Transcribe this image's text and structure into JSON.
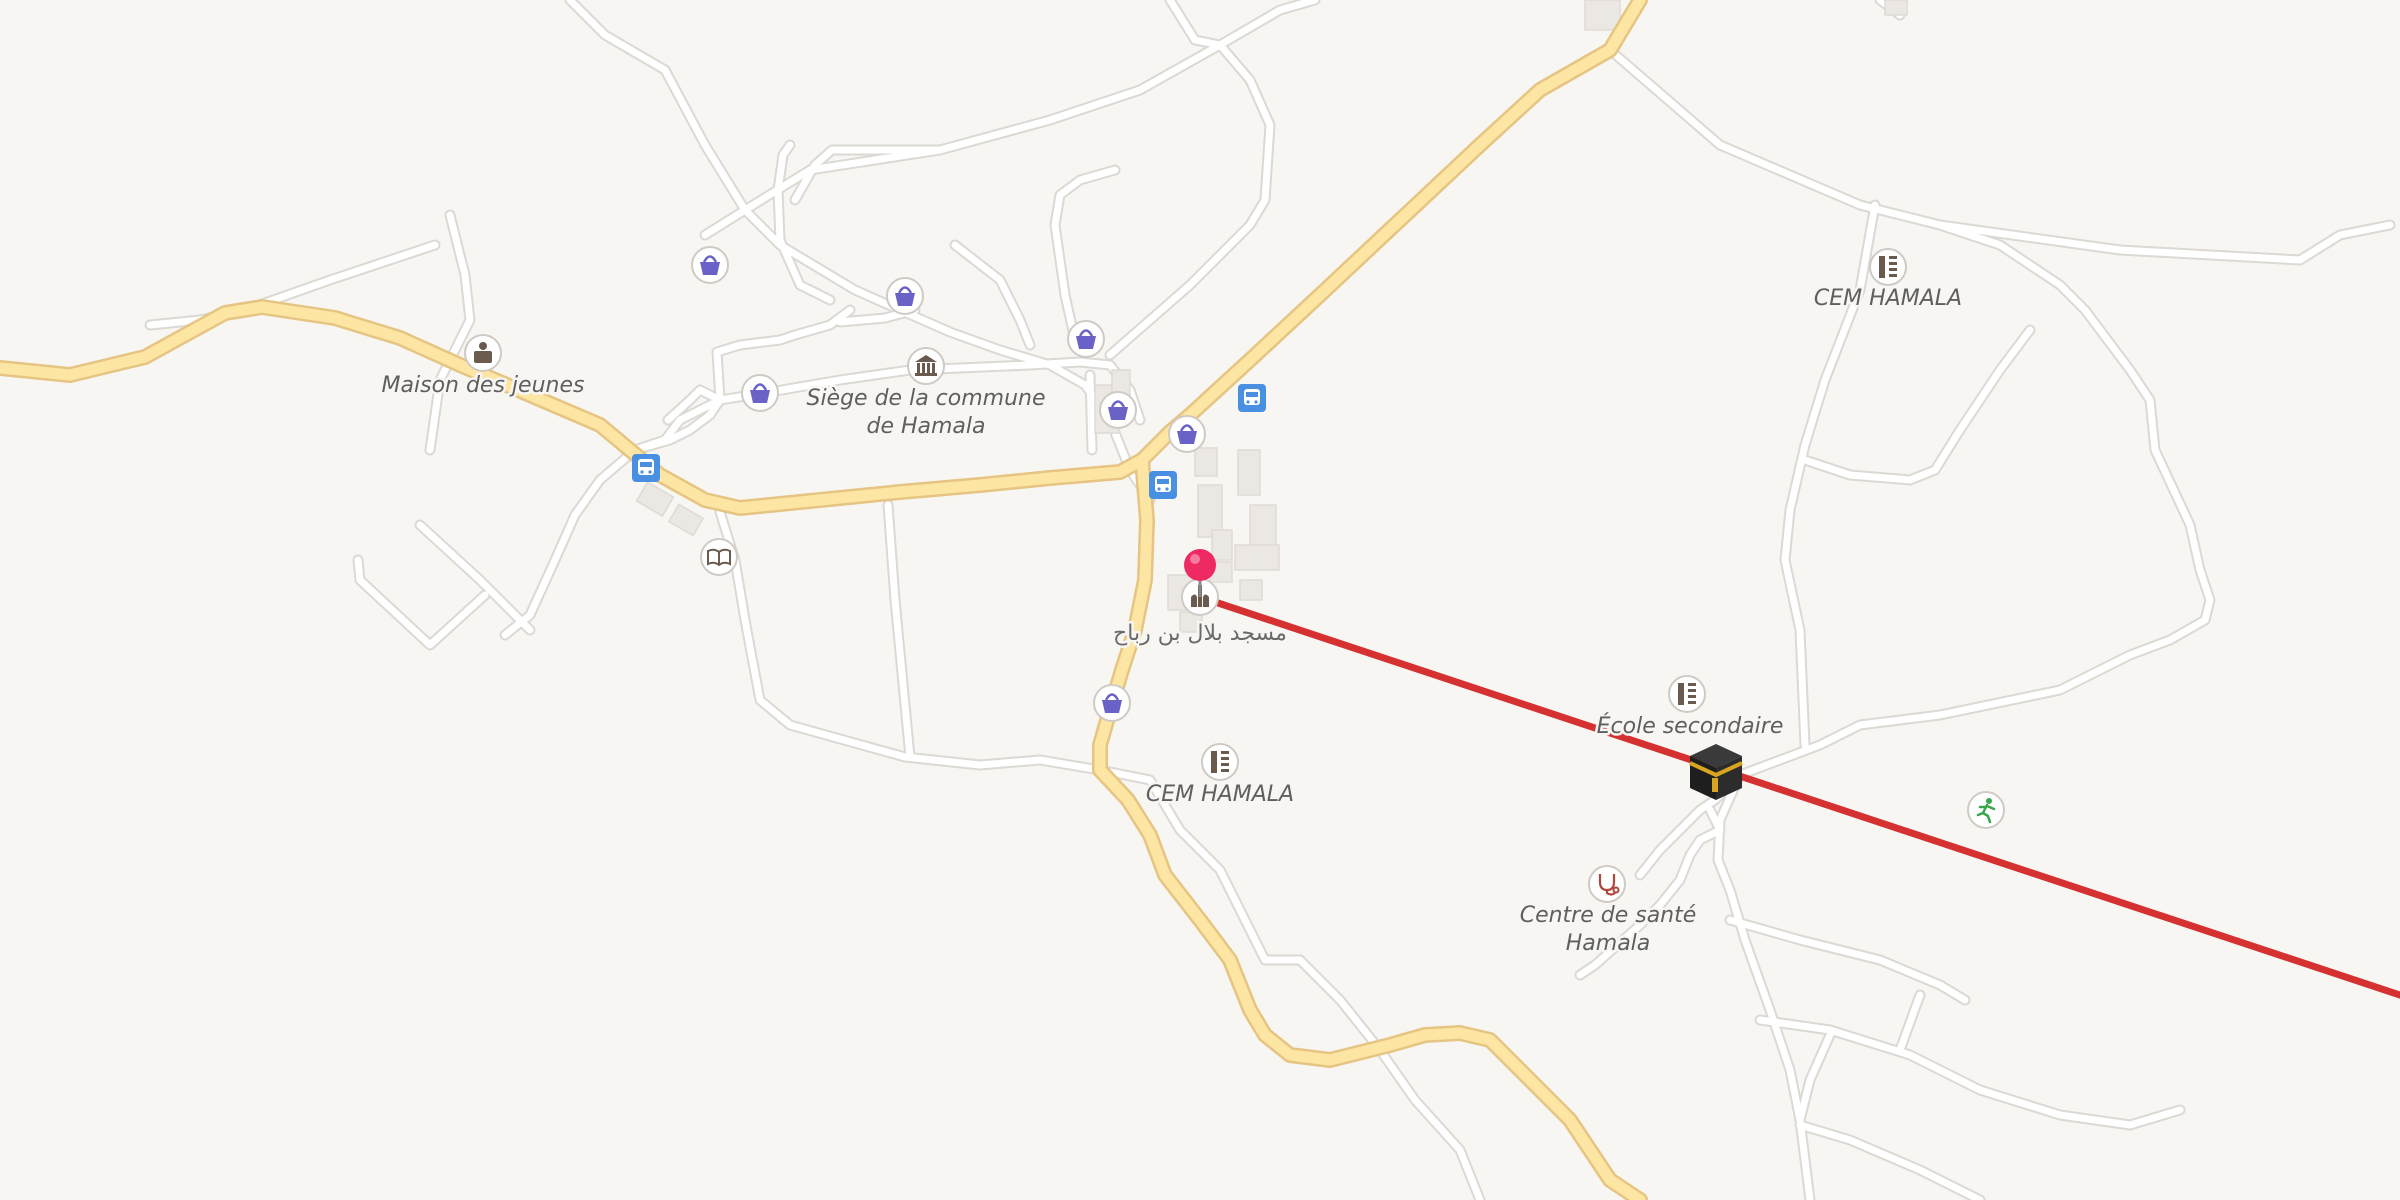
{
  "map": {
    "colors": {
      "background": "#f8f6f3",
      "minor_road": "#ffffff",
      "minor_road_casing": "#dedad5",
      "main_road": "#fde6a4",
      "main_road_casing": "#eac888",
      "building": "#ebe7e2",
      "route_line": "#d63131",
      "marker": "#ee2a62",
      "shop_icon": "#6a62c6",
      "bus_stop": "#4a90e2",
      "poi_icon": "#6b5a4e"
    },
    "labels": {
      "maison_des_jeunes": "Maison des jeunes",
      "siege_line1": "Siège de la commune",
      "siege_line2": "de Hamala",
      "mosque": "مسجد بلال بن رباح",
      "cem_hamala_center": "CEM HAMALA",
      "cem_hamala_ne": "CEM HAMALA",
      "ecole_secondaire": "École secondaire",
      "centre_sante_line1": "Centre de santé",
      "centre_sante_line2": "Hamala"
    },
    "icons": {
      "shop": "shopping-basket-icon",
      "bus": "bus-stop-icon",
      "town_hall": "town-hall-icon",
      "community_centre": "community-centre-icon",
      "library": "open-book-icon",
      "mosque": "mosque-icon",
      "school": "school-icon",
      "health": "stethoscope-icon",
      "sports": "running-person-icon",
      "destination": "kaaba-icon",
      "location": "location-pin-icon"
    }
  }
}
